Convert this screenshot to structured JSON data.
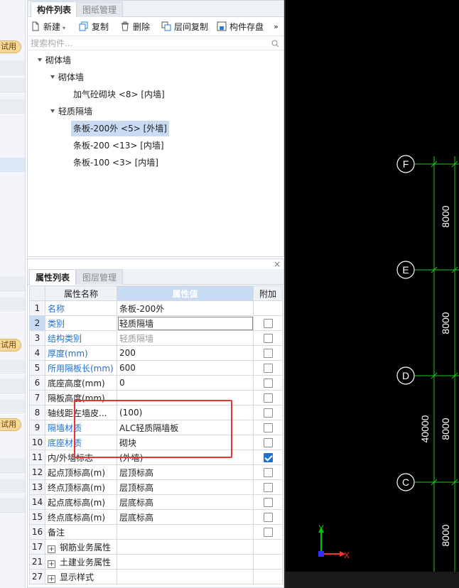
{
  "left_strip": {
    "trial_badge": "试用"
  },
  "component_panel": {
    "tabs": [
      "构件列表",
      "图纸管理"
    ],
    "toolbar": {
      "new": "新建",
      "copy": "复制",
      "delete": "删除",
      "floor_copy": "层间复制",
      "save": "构件存盘",
      "more": "»"
    },
    "search_placeholder": "搜索构件...",
    "tree": [
      {
        "label": "砌体墙"
      },
      {
        "label": "砌体墙"
      },
      {
        "label": "加气砼砌块 <8> [内墙]"
      },
      {
        "label": "轻质隔墙"
      },
      {
        "label": "条板-200外 <5> [外墙]"
      },
      {
        "label": "条板-200 <13> [内墙]"
      },
      {
        "label": "条板-100 <3> [内墙]"
      }
    ]
  },
  "property_panel": {
    "close": "×",
    "tabs": [
      "属性列表",
      "图层管理"
    ],
    "headers": {
      "name": "属性名称",
      "value": "属性值",
      "extra": "附加"
    },
    "rows": [
      {
        "num": "1",
        "name": "名称",
        "value": "条板-200外"
      },
      {
        "num": "2",
        "name": "类别",
        "value": "轻质隔墙"
      },
      {
        "num": "3",
        "name": "结构类别",
        "value": "轻质隔墙"
      },
      {
        "num": "4",
        "name": "厚度(mm)",
        "value": "200"
      },
      {
        "num": "5",
        "name": "所用隔板长(mm)",
        "value": "600"
      },
      {
        "num": "6",
        "name": "底座高度(mm)",
        "value": "0"
      },
      {
        "num": "7",
        "name": "隔板高度(mm)",
        "value": ""
      },
      {
        "num": "8",
        "name": "轴线距左墙皮...",
        "value": "(100)"
      },
      {
        "num": "9",
        "name": "隔墙材质",
        "value": "ALC轻质隔墙板"
      },
      {
        "num": "10",
        "name": "底座材质",
        "value": "砌块"
      },
      {
        "num": "11",
        "name": "内/外墙标志",
        "value": "(外墙)"
      },
      {
        "num": "12",
        "name": "起点顶标高(m)",
        "value": "层顶标高"
      },
      {
        "num": "13",
        "name": "终点顶标高(m)",
        "value": "层顶标高"
      },
      {
        "num": "14",
        "name": "起点底标高(m)",
        "value": "层底标高"
      },
      {
        "num": "15",
        "name": "终点底标高(m)",
        "value": "层底标高"
      },
      {
        "num": "16",
        "name": "备注",
        "value": ""
      },
      {
        "num": "17",
        "name": "钢筋业务属性",
        "value": ""
      },
      {
        "num": "21",
        "name": "土建业务属性",
        "value": ""
      },
      {
        "num": "27",
        "name": "显示样式",
        "value": ""
      }
    ]
  },
  "cad": {
    "axes": [
      "F",
      "E",
      "D",
      "C"
    ],
    "dims": [
      "8000",
      "8000",
      "8000",
      "8000"
    ],
    "total_dim": "40000",
    "ucs": {
      "y": "Y",
      "x": "X"
    },
    "colors": {
      "axis_line": "#1ec81e",
      "ucs_x": "#ff3030",
      "ucs_y": "#00c800",
      "ucs_origin": "#3030ff"
    }
  }
}
